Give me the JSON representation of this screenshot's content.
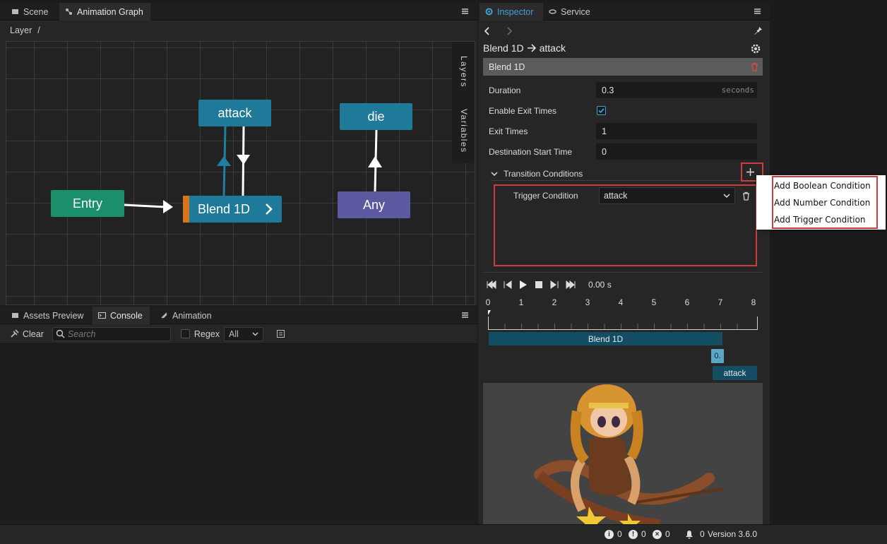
{
  "left_top": {
    "tabs": [
      {
        "label": "Scene"
      },
      {
        "label": "Animation Graph"
      }
    ],
    "layer_label": "Layer",
    "layer_path": "/",
    "side_tabs": {
      "layers": "Layers",
      "variables": "Variables"
    },
    "nodes": {
      "entry": "Entry",
      "blend1d": "Blend 1D",
      "attack": "attack",
      "die": "die",
      "any": "Any"
    }
  },
  "left_bottom": {
    "tabs": [
      {
        "label": "Assets Preview"
      },
      {
        "label": "Console"
      },
      {
        "label": "Animation"
      }
    ],
    "clear_label": "Clear",
    "search_placeholder": "Search",
    "regex_label": "Regex",
    "filter_value": "All"
  },
  "inspector": {
    "tabs": [
      {
        "label": "Inspector"
      },
      {
        "label": "Service"
      }
    ],
    "title_from": "Blend 1D",
    "title_to": "attack",
    "section": "Blend 1D",
    "properties": {
      "duration_label": "Duration",
      "duration_value": "0.3",
      "duration_unit": "seconds",
      "enable_exit_label": "Enable Exit Times",
      "enable_exit_checked": true,
      "exit_times_label": "Exit Times",
      "exit_times_value": "1",
      "dest_start_label": "Destination Start Time",
      "dest_start_value": "0"
    },
    "transition_conditions_label": "Transition Conditions",
    "trigger_condition_label": "Trigger Condition",
    "trigger_condition_value": "attack",
    "time_display": "0.00 s",
    "ruler_ticks": [
      "0",
      "1",
      "2",
      "3",
      "4",
      "5",
      "6",
      "7",
      "8"
    ],
    "tracks": {
      "blend": "Blend 1D",
      "transition": "0.",
      "attack": "attack"
    }
  },
  "popup": {
    "items": [
      "Add Boolean Condition",
      "Add Number Condition",
      "Add Trigger Condition"
    ]
  },
  "footer": {
    "info_count": "0",
    "warn_count": "0",
    "error_count": "0",
    "notify_count": "0",
    "version": "Version 3.6.0"
  },
  "colors": {
    "accent_blue": "#1f7a99",
    "entry_green": "#1b8f6c",
    "any_purple": "#5b5aa0",
    "highlight_red": "#d23b3b"
  }
}
